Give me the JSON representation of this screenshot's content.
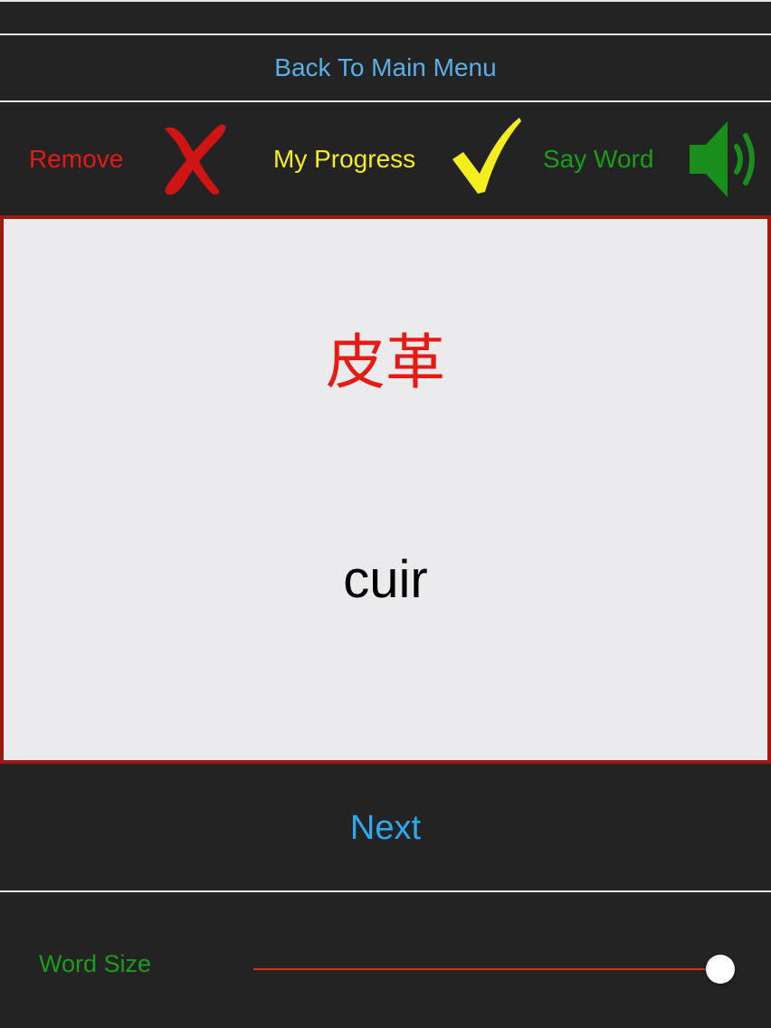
{
  "nav": {
    "back_label": "Back To Main Menu"
  },
  "toolbar": {
    "remove_label": "Remove",
    "progress_label": "My Progress",
    "say_word_label": "Say Word"
  },
  "card": {
    "native_word": "皮革",
    "target_word": "cuir"
  },
  "next_label": "Next",
  "word_size": {
    "label": "Word Size",
    "value_fraction": 1.0
  },
  "icons": {
    "remove": "red-x-icon",
    "progress": "yellow-checkmark-icon",
    "say_word": "speaker-icon"
  },
  "colors": {
    "link_blue": "#5aaee6",
    "next_blue": "#2fa8ee",
    "remove_red": "#e51a16",
    "progress_yellow": "#f4ee1f",
    "say_green": "#1a9e1a",
    "native_word_red": "#e81a14",
    "card_border": "#9a1b12",
    "slider_fill": "#d8321e"
  }
}
